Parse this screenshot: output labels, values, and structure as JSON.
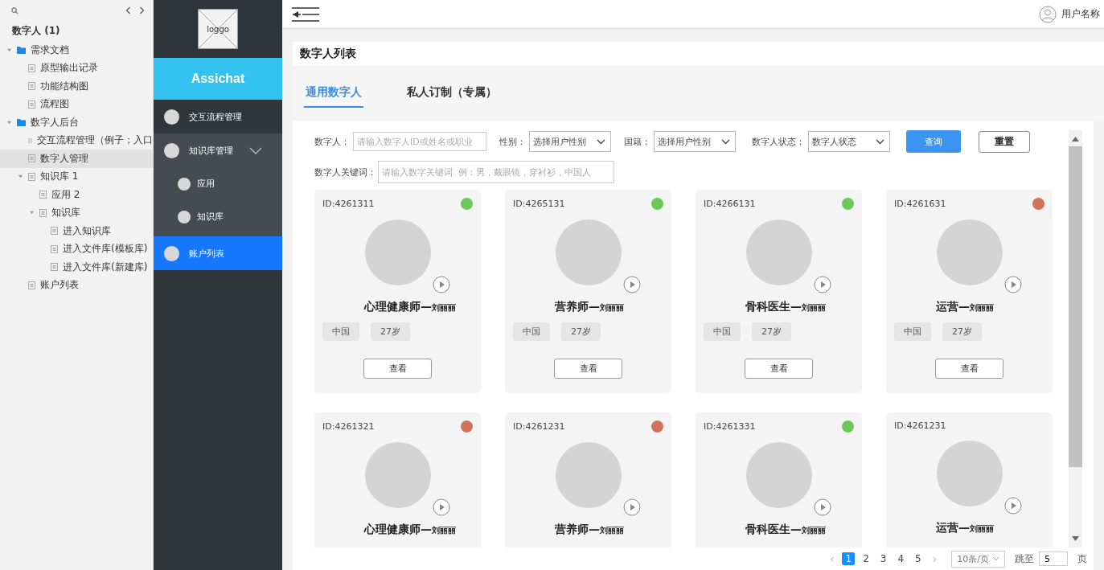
{
  "tree": {
    "title": "数字人 (1)",
    "items": [
      {
        "label": "需求文档",
        "kind": "folder",
        "expanded": true,
        "selected": false,
        "children": [
          {
            "label": "原型输出记录",
            "kind": "page",
            "selected": false
          },
          {
            "label": "功能结构图",
            "kind": "page",
            "selected": false
          },
          {
            "label": "流程图",
            "kind": "page",
            "selected": false
          }
        ]
      },
      {
        "label": "数字人后台",
        "kind": "folder",
        "expanded": true,
        "selected": false,
        "children": [
          {
            "label": "交互流程管理（例子；入口",
            "kind": "page",
            "selected": false
          },
          {
            "label": "数字人管理",
            "kind": "page",
            "selected": true
          },
          {
            "label": "知识库 1",
            "kind": "page",
            "expanded": true,
            "selected": false,
            "children": [
              {
                "label": "应用 2",
                "kind": "page",
                "selected": false
              },
              {
                "label": "知识库",
                "kind": "page",
                "expanded": true,
                "selected": false,
                "children": [
                  {
                    "label": "进入知识库",
                    "kind": "page",
                    "selected": false
                  },
                  {
                    "label": "进入文件库(模板库)",
                    "kind": "page",
                    "selected": false
                  },
                  {
                    "label": "进入文件库(新建库)",
                    "kind": "page",
                    "selected": false
                  }
                ]
              }
            ]
          },
          {
            "label": "账户列表",
            "kind": "page",
            "selected": false
          }
        ]
      }
    ]
  },
  "nav": {
    "logo": "loggo",
    "brand": "Assichat",
    "items": [
      {
        "label": "交互流程管理",
        "selected": false
      },
      {
        "label": "知识库管理",
        "selected": false,
        "expanded": true,
        "children": [
          {
            "label": "应用",
            "selected": false
          },
          {
            "label": "知识库",
            "selected": false
          }
        ]
      },
      {
        "label": "账户列表",
        "selected": true
      }
    ]
  },
  "header": {
    "user": "用户名称"
  },
  "page_title": "数字人列表",
  "tabs": [
    {
      "label": "通用数字人",
      "selected": true
    },
    {
      "label": "私人订制（专属）",
      "selected": false
    }
  ],
  "filters": {
    "fields": [
      {
        "kind": "input",
        "label": "数字人：",
        "placeholder": "请输入数字人ID或姓名或职业"
      },
      {
        "kind": "select",
        "label": "性别：",
        "value": "选择用户性别"
      },
      {
        "kind": "select",
        "label": "国籍：",
        "value": "选择用户性别"
      },
      {
        "kind": "select",
        "label": "数字人状态：",
        "value": "数字人状态"
      },
      {
        "kind": "input",
        "label": "数字人关键词：",
        "placeholder": "请输入数字关键词  例：男，戴眼镜，穿衬衫，中国人"
      }
    ],
    "search_button": "查询",
    "reset_button": "重置"
  },
  "cards": [
    {
      "id": "ID:4261311",
      "color": "#6cc858",
      "role": "心理健康师—",
      "person": "刘丽丽",
      "country": "中国",
      "age": "27岁",
      "button": "查看"
    },
    {
      "id": "ID:4265131",
      "color": "#6cc858",
      "role": "营养师—",
      "person": "刘丽丽",
      "country": "中国",
      "age": "27岁",
      "button": "查看"
    },
    {
      "id": "ID:4266131",
      "color": "#6cc858",
      "role": "骨科医生—",
      "person": "刘丽丽",
      "country": "中国",
      "age": "27岁",
      "button": "查看"
    },
    {
      "id": "ID:4261631",
      "color": "#d0735a",
      "role": "运营—",
      "person": "刘丽丽",
      "country": "中国",
      "age": "27岁",
      "button": "查看"
    },
    {
      "id": "ID:4261321",
      "color": "#d0735a",
      "role": "心理健康师—",
      "person": "刘丽丽"
    },
    {
      "id": "ID:4261231",
      "color": "#d0735a",
      "role": "营养师—",
      "person": "刘丽丽"
    },
    {
      "id": "ID:4261331",
      "color": "#6cc858",
      "role": "骨科医生—",
      "person": "刘丽丽"
    },
    {
      "id": "ID:4261231",
      "role": "运营—",
      "person": "刘丽丽"
    }
  ],
  "pagination": {
    "prev": "‹",
    "pages": [
      {
        "label": "1",
        "selected": true
      },
      {
        "label": "2",
        "selected": false
      },
      {
        "label": "3",
        "selected": false
      },
      {
        "label": "4",
        "selected": false
      },
      {
        "label": "5",
        "selected": false
      }
    ],
    "next": "›",
    "page_size": "10条/页",
    "jump_label": "跳至",
    "jump_value": "5",
    "jump_suffix": "页"
  }
}
